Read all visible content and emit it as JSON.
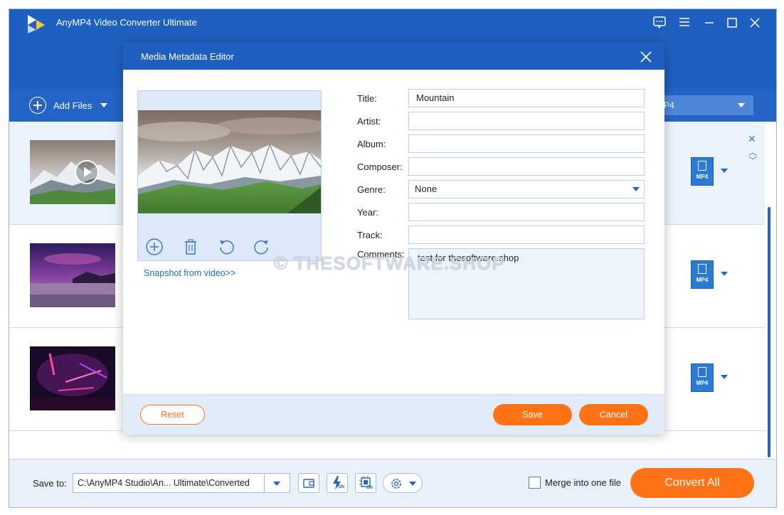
{
  "app": {
    "title": "AnyMP4 Video Converter Ultimate",
    "logo_icon": "anymp4-logo",
    "window_controls": [
      "feedback-icon",
      "menu-icon",
      "minimize-icon",
      "maximize-icon",
      "close-icon"
    ]
  },
  "toolbar": {
    "add_files_label": "Add Files",
    "format_label": "MP4"
  },
  "file_list": {
    "items": [
      {
        "format_badge": "MP4",
        "selected": true
      },
      {
        "format_badge": "MP4",
        "selected": false
      },
      {
        "format_badge": "MP4",
        "selected": false
      }
    ]
  },
  "dialog": {
    "title": "Media Metadata Editor",
    "snapshot_link": "Snapshot from video>>",
    "cover_tools": [
      "add-icon",
      "delete-icon",
      "rotate-left-icon",
      "rotate-right-icon"
    ],
    "fields": {
      "title_label": "Title:",
      "title_value": "Mountain",
      "artist_label": "Artist:",
      "artist_value": "",
      "album_label": "Album:",
      "album_value": "",
      "composer_label": "Composer:",
      "composer_value": "",
      "genre_label": "Genre:",
      "genre_value": "None",
      "year_label": "Year:",
      "year_value": "",
      "track_label": "Track:",
      "track_value": "",
      "comments_label": "Comments:",
      "comments_value": "test for thesoftware.shop"
    },
    "buttons": {
      "reset": "Reset",
      "save": "Save",
      "cancel": "Cancel"
    }
  },
  "bottom_bar": {
    "save_to_label": "Save to:",
    "save_path": "C:\\AnyMP4 Studio\\An... Ultimate\\Converted",
    "hw_accel_badge": "ON",
    "gpu_badge": "ON",
    "merge_label": "Merge into one file",
    "merge_checked": false,
    "convert_all_label": "Convert All"
  },
  "watermark": "© THESOFTWARE.SHOP",
  "colors": {
    "header_blue": "#1f5fbf",
    "accent_orange": "#ff7316",
    "link_blue": "#2468c2"
  }
}
